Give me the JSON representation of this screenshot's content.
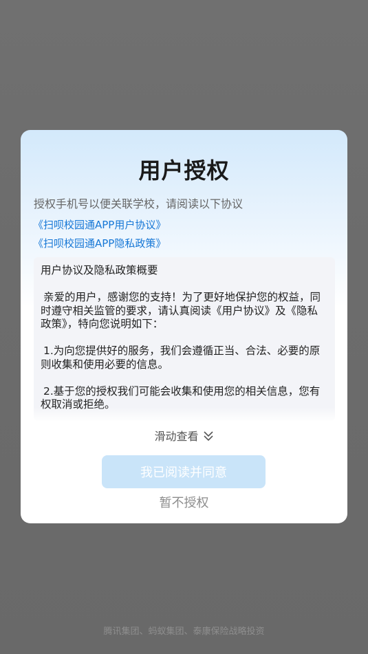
{
  "background": {
    "footer_text": "腾讯集团、蚂蚁集团、泰康保险战略投资"
  },
  "dialog": {
    "title": "用户授权",
    "subtitle": "授权手机号以便关联学校，请阅读以下协议",
    "links": [
      "《扫呗校园通APP用户协议》",
      "《扫呗校园通APP隐私政策》"
    ],
    "summary": {
      "heading": "用户协议及隐私政策概要",
      "paragraphs": [
        "亲爱的用户，感谢您的支持！为了更好地保护您的权益，同时遵守相关监管的要求，请认真阅读《用户协议》及《隐私政策》，特向您说明如下：",
        "1.为向您提供好的服务，我们会遵循正当、合法、必要的原则收集和使用必要的信息。",
        "2.基于您的授权我们可能会收集和使用您的相关信息，您有权取消或拒绝。"
      ]
    },
    "scroll_hint": "滑动查看",
    "scroll_hint_icon": "double-chevron-down-icon",
    "agree_label": "我已阅读并同意",
    "decline_label": "暂不授权"
  },
  "colors": {
    "link": "#1677d6",
    "agree_button_bg": "#c9e4f9",
    "overlay": "#6b6b6b"
  }
}
